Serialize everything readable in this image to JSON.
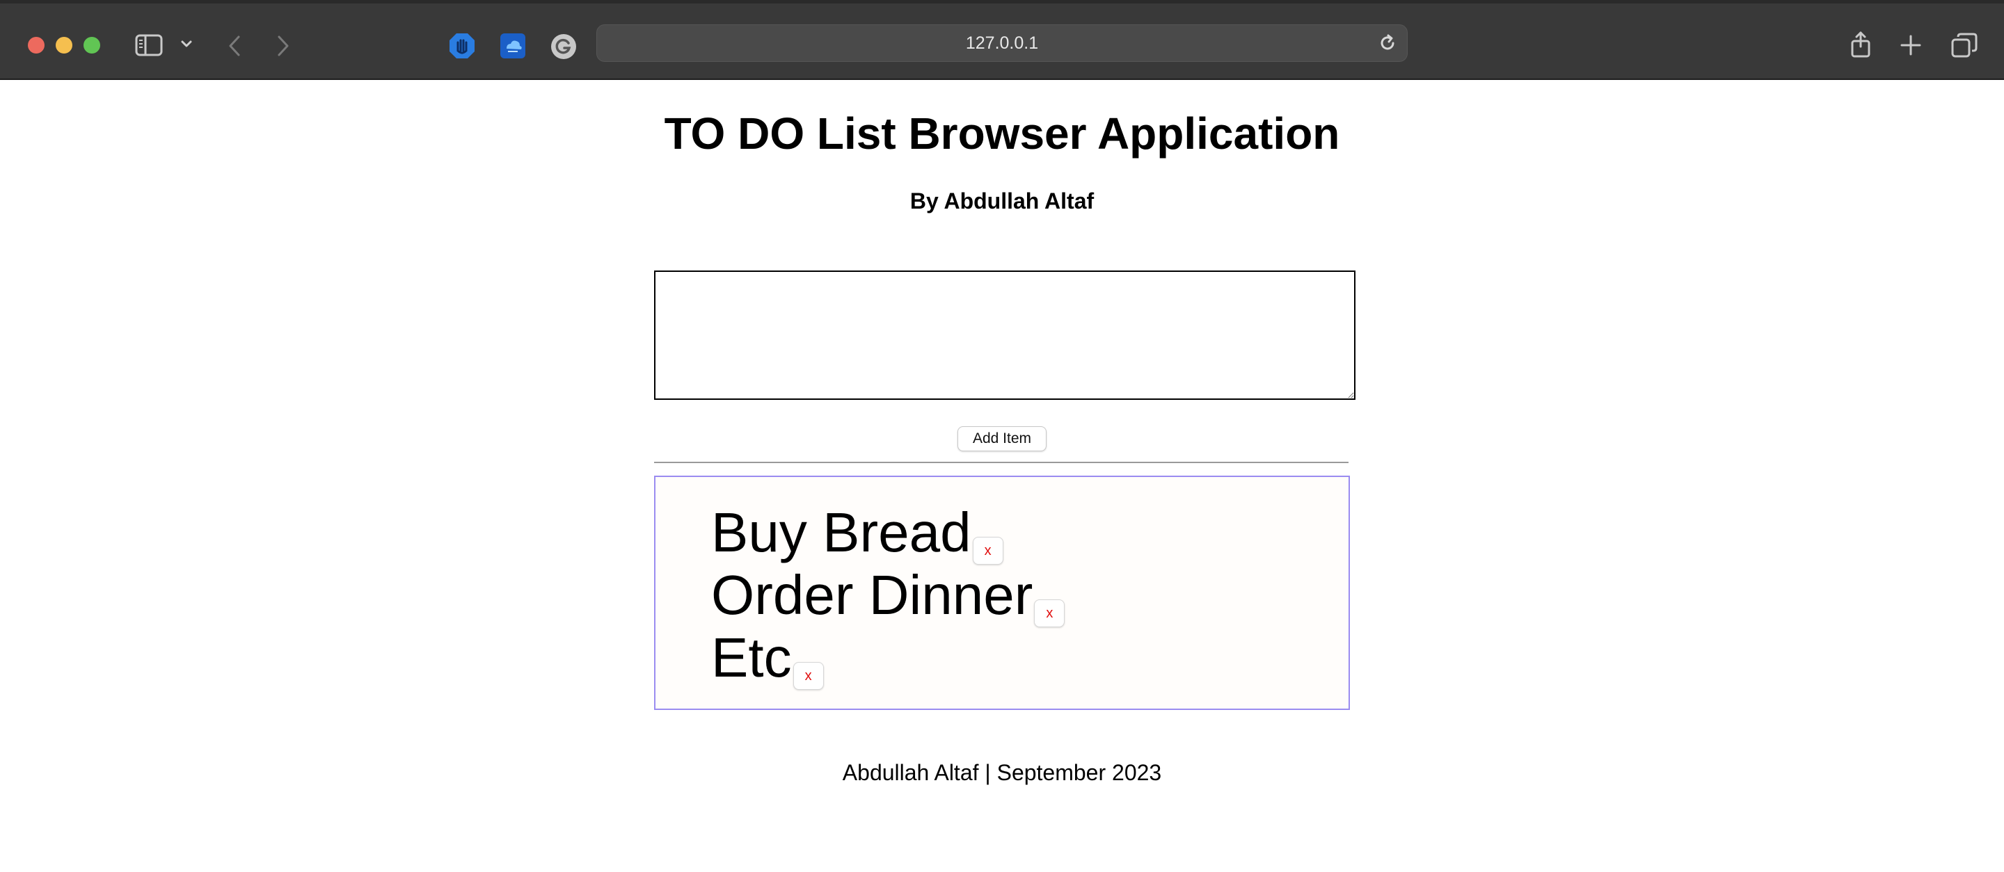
{
  "browser": {
    "url": "127.0.0.1"
  },
  "page": {
    "title": "TO DO List Browser Application",
    "subtitle": "By Abdullah Altaf",
    "input": {
      "value": "",
      "placeholder": ""
    },
    "add_button_label": "Add Item",
    "todo_items": [
      {
        "text": "Buy Bread",
        "remove_label": "x"
      },
      {
        "text": "Order Dinner",
        "remove_label": "x"
      },
      {
        "text": "Etc",
        "remove_label": "x"
      }
    ],
    "footer": "Abdullah Altaf | September 2023"
  },
  "colors": {
    "toolbar_bg": "#393939",
    "list_border": "#9a8cf0",
    "remove_text": "#e01010"
  },
  "icons": [
    "close-window-icon",
    "minimize-window-icon",
    "zoom-window-icon",
    "sidebar-icon",
    "chevron-down-icon",
    "back-arrow-icon",
    "forward-arrow-icon",
    "hand-extension-icon",
    "cloud-extension-icon",
    "grammarly-extension-icon",
    "reload-icon",
    "share-icon",
    "new-tab-icon",
    "tab-overview-icon"
  ]
}
